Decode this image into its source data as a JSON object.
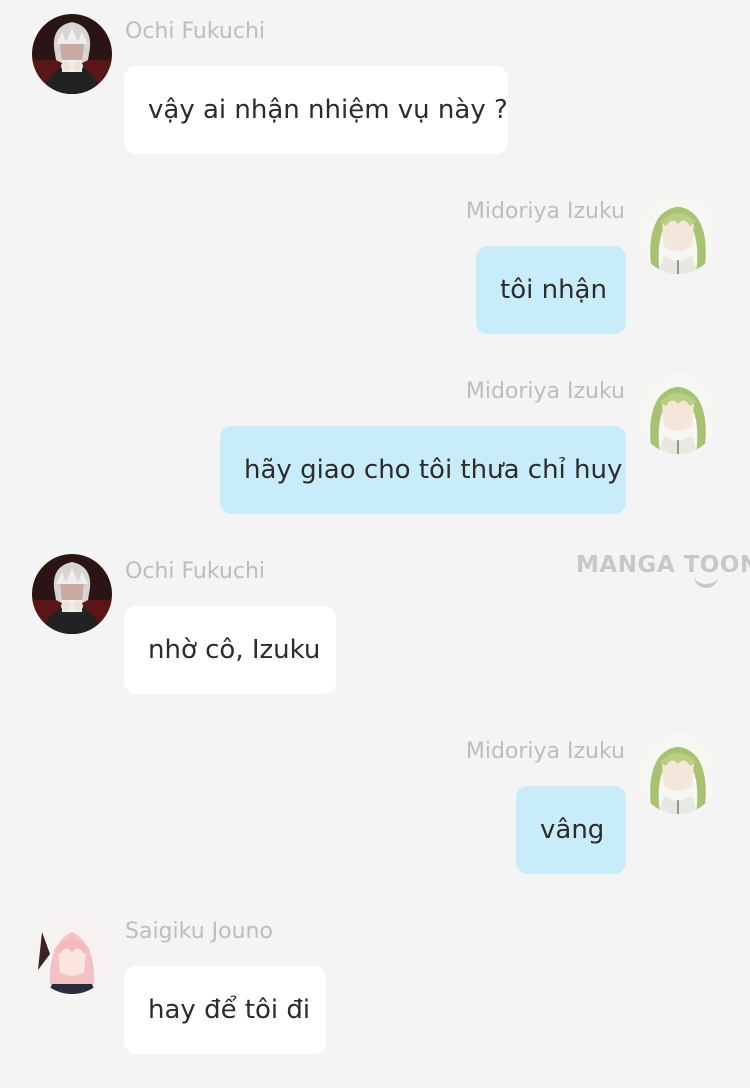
{
  "messages": [
    {
      "sender": "Ochi Fukuchi",
      "text": "vậy ai nhận nhiệm vụ này ?",
      "side": "left",
      "avatar_icon": "white-haired-man-avatar-icon"
    },
    {
      "sender": "Midoriya Izuku",
      "text": "tôi nhận",
      "side": "right",
      "avatar_icon": "green-haired-girl-avatar-icon"
    },
    {
      "sender": "Midoriya Izuku",
      "text": "hãy giao cho tôi thưa chỉ huy",
      "side": "right",
      "avatar_icon": "green-haired-girl-avatar-icon"
    },
    {
      "sender": "Ochi Fukuchi",
      "text": "nhờ cô, Izuku",
      "side": "left",
      "avatar_icon": "white-haired-man-avatar-icon"
    },
    {
      "sender": "Midoriya Izuku",
      "text": "vâng",
      "side": "right",
      "avatar_icon": "green-haired-girl-avatar-icon"
    },
    {
      "sender": "Saigiku Jouno",
      "text": "hay để tôi đi",
      "side": "left",
      "avatar_icon": "pink-haired-avatar-icon"
    }
  ],
  "watermark": "MANGA TOON",
  "colors": {
    "background": "#f4f4f4",
    "incoming_bubble": "#ffffff",
    "outgoing_bubble": "#c9ecfb",
    "sender_name": "#bdbdbd",
    "message_text": "#2c2c2c"
  }
}
